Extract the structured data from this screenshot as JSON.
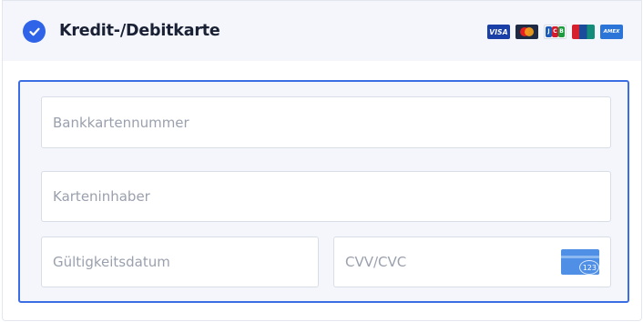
{
  "payment": {
    "title": "Kredit-/Debitkarte",
    "selected": true,
    "brands": [
      "VISA",
      "Mastercard",
      "JCB",
      "UnionPay",
      "AMEX"
    ],
    "brand_labels": {
      "visa": "VISA",
      "jcb": [
        "J",
        "C",
        "B"
      ],
      "unionpay": "UnionPay",
      "amex": "AMEX"
    }
  },
  "form": {
    "card_number_placeholder": "Bankkartennummer",
    "card_holder_placeholder": "Karteninhaber",
    "expiry_placeholder": "Gültigkeitsdatum",
    "cvv_placeholder": "CVV/CVC",
    "cvv_icon_text": "123"
  },
  "colors": {
    "accent": "#2f64e8",
    "header_bg": "#f4f6fc",
    "form_border": "#3b6de4",
    "placeholder_text": "#9aa0ad"
  }
}
